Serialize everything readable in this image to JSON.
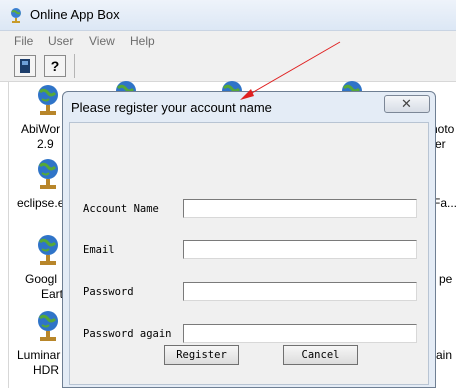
{
  "window": {
    "title": "Online App Box"
  },
  "menu": [
    "File",
    "User",
    "View",
    "Help"
  ],
  "toolbar": [
    {
      "icon": "book-icon"
    },
    {
      "icon": "help-question-icon",
      "glyph": "?"
    }
  ],
  "apps": [
    {
      "label_lines": [
        "AbiWor",
        "2.9"
      ]
    },
    {
      "label_lines": [
        "eclipse.e"
      ]
    },
    {
      "label_lines": [
        "Googl",
        "Earth"
      ]
    },
    {
      "label_lines": [
        "Luminar",
        "HDR"
      ]
    },
    {
      "label_lines": [
        "hoto",
        "er"
      ]
    },
    {
      "label_lines": [
        "Fa..."
      ]
    },
    {
      "label_lines": [
        "pe"
      ]
    },
    {
      "label_lines": [
        "ain"
      ]
    }
  ],
  "dialog": {
    "title": "Please register your account name",
    "close_glyph": "✕",
    "fields": [
      {
        "label": "Account Name",
        "value": ""
      },
      {
        "label": "Email",
        "value": ""
      },
      {
        "label": "Password",
        "value": ""
      },
      {
        "label": "Password again",
        "value": ""
      }
    ],
    "register_label": "Register",
    "cancel_label": "Cancel"
  },
  "colors": {
    "arrow": "#e02020",
    "dialog_frame": "#e4ecf6",
    "dialog_body": "#f0f0f0"
  }
}
